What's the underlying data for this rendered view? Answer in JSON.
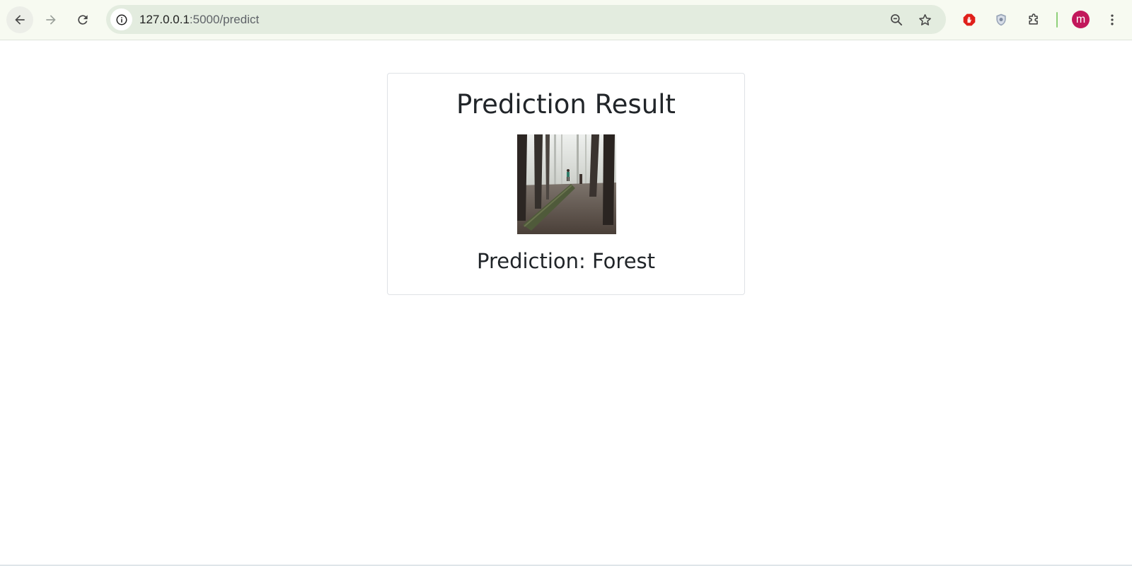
{
  "browser": {
    "url_host": "127.0.0.1",
    "url_path": ":5000/predict",
    "profile_initial": "m",
    "icons": {
      "back": "arrow-left-icon",
      "forward": "arrow-right-icon",
      "reload": "reload-icon",
      "site_info": "info-icon",
      "zoom": "zoom-out-icon",
      "bookmark": "star-icon",
      "ext_1": "stop-hand-icon",
      "ext_2": "shield-icon",
      "extensions": "puzzle-icon",
      "menu": "kebab-menu-icon"
    },
    "colors": {
      "toolbar_bg": "#f7faf1",
      "omnibox_bg": "#e3ecdf",
      "avatar_bg": "#c2185b",
      "adblock_red": "#e0201b"
    }
  },
  "page": {
    "title": "Prediction Result",
    "prediction_text": "Prediction: Forest"
  }
}
